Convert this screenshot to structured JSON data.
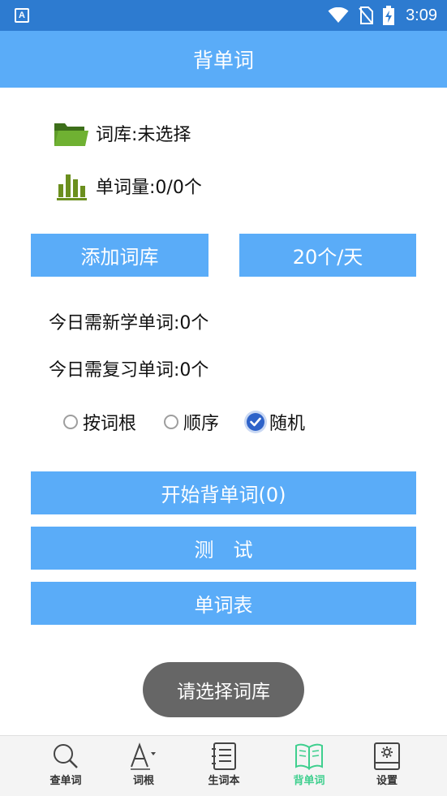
{
  "status_bar": {
    "app_icon_letter": "A",
    "time": "3:09"
  },
  "header": {
    "title": "背单词"
  },
  "library": {
    "label": "词库:未选择"
  },
  "word_count": {
    "label": "单词量:0/0个"
  },
  "buttons": {
    "add_library": "添加词库",
    "per_day": "20个/天",
    "start": "开始背单词(0)",
    "test": "测　试",
    "word_list": "单词表"
  },
  "today": {
    "new_words": "今日需新学单词:0个",
    "review_words": "今日需复习单词:0个"
  },
  "order_options": [
    {
      "label": "按词根",
      "checked": false
    },
    {
      "label": "顺序",
      "checked": false
    },
    {
      "label": "随机",
      "checked": true
    }
  ],
  "toast": {
    "text": "请选择词库"
  },
  "bottom_nav": [
    {
      "label": "查单词",
      "icon": "search-icon",
      "active": false
    },
    {
      "label": "词根",
      "icon": "font-icon",
      "active": false
    },
    {
      "label": "生词本",
      "icon": "notebook-icon",
      "active": false
    },
    {
      "label": "背单词",
      "icon": "book-icon",
      "active": true
    },
    {
      "label": "设置",
      "icon": "settings-icon",
      "active": false
    }
  ],
  "colors": {
    "status_bar": "#2d7bd0",
    "primary": "#5aacf8",
    "active_nav": "#3ecf8e",
    "folder_green": "#4c8a22",
    "toast": "#666666"
  }
}
